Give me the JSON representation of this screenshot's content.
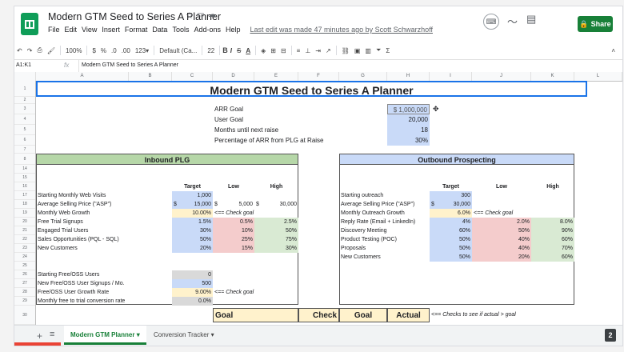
{
  "app": {
    "doc_title": "Modern GTM Seed to Series A Planner",
    "menu": [
      "File",
      "Edit",
      "View",
      "Insert",
      "Format",
      "Data",
      "Tools",
      "Add-ons",
      "Help"
    ],
    "last_edit": "Last edit was made 47 minutes ago by Scott Schwarzhoff",
    "share_label": "Share"
  },
  "toolbar": {
    "zoom": "100%",
    "currency": "$",
    "percent": "%",
    "dec_down": ".0",
    "dec_up": ".00",
    "format": "123▾",
    "font": "Default (Ca...",
    "font_size": "22",
    "bold": "B",
    "italic": "I",
    "strike": "S",
    "text_color": "A"
  },
  "formula": {
    "cell_ref": "A1:K1",
    "fx": "fx",
    "value": "Modern GTM Seed to Series A Planner"
  },
  "columns": [
    "A",
    "B",
    "C",
    "D",
    "E",
    "F",
    "G",
    "H",
    "I",
    "J",
    "K",
    "L"
  ],
  "rows": [
    "1",
    "2",
    "3",
    "4",
    "5",
    "6",
    "7",
    "8",
    "14",
    "15",
    "16",
    "17",
    "18",
    "19",
    "20",
    "21",
    "22",
    "23",
    "24",
    "25",
    "26",
    "27",
    "28",
    "29",
    "30"
  ],
  "sheet": {
    "title": "Modern GTM Seed to Series A Planner",
    "goals": [
      {
        "label": "ARR Goal",
        "value": "$ 1,000,000"
      },
      {
        "label": "User Goal",
        "value": "20,000"
      },
      {
        "label": "Months until next raise",
        "value": "18"
      },
      {
        "label": "Percentage of ARR from PLG at Raise",
        "value": "30%"
      }
    ],
    "inbound": {
      "header": "Inbound PLG",
      "col_target": "Target",
      "col_low": "Low",
      "col_high": "High",
      "rows": [
        {
          "label": "Starting Monthly Web Visits",
          "target": "1,000",
          "low": "",
          "high": ""
        },
        {
          "label": "Average Selling Price (\"ASP\")",
          "target_cur": "$",
          "target": "15,000",
          "low_cur": "$",
          "low": "5,000",
          "high_cur": "$",
          "high": "30,000"
        },
        {
          "label": "Monthly Web Growth",
          "target": "10.00%",
          "note": "<== Check goal"
        },
        {
          "label": "Free Trial Signups",
          "target": "1.5%",
          "low": "0.5%",
          "high": "2.5%"
        },
        {
          "label": "Engaged Trial Users",
          "target": "30%",
          "low": "10%",
          "high": "50%"
        },
        {
          "label": "Sales Opportunities (PQL - SQL)",
          "target": "50%",
          "low": "25%",
          "high": "75%"
        },
        {
          "label": "New Customers",
          "target": "20%",
          "low": "15%",
          "high": "30%"
        }
      ],
      "oss": [
        {
          "label": "Starting Free/OSS Users",
          "value": "0"
        },
        {
          "label": "New Free/OSS User Signups / Mo.",
          "value": "500"
        },
        {
          "label": "Free/OSS User Growth Rate",
          "value": "9.00%",
          "note": "<== Check goal"
        },
        {
          "label": "Monthly free to trial conversion rate",
          "value": "0.0%"
        }
      ]
    },
    "outbound": {
      "header": "Outbound Prospecting",
      "col_target": "Target",
      "col_low": "Low",
      "col_high": "High",
      "rows": [
        {
          "label": "Starting outreach",
          "target": "300",
          "low": "",
          "high": ""
        },
        {
          "label": "Average Selling Price (\"ASP\")",
          "target_cur": "$",
          "target": "30,000"
        },
        {
          "label": "Monthly Outreach Growth",
          "target": "6.0%",
          "note": "<== Check goal"
        },
        {
          "label": "Reply Rate (Email + LinkedIn)",
          "target": "4%",
          "low": "2.0%",
          "high": "8.0%"
        },
        {
          "label": "Discovery Meeting",
          "target": "60%",
          "low": "50%",
          "high": "90%"
        },
        {
          "label": "Product Testing (POC)",
          "target": "50%",
          "low": "40%",
          "high": "60%"
        },
        {
          "label": "Proposals",
          "target": "50%",
          "low": "40%",
          "high": "70%"
        },
        {
          "label": "New Customers",
          "target": "50%",
          "low": "20%",
          "high": "60%"
        }
      ]
    },
    "bottom": {
      "goal": "Goal",
      "check": "Check",
      "goal2": "Goal",
      "actual": "Actual",
      "note": "<== Checks to see if actual > goal"
    }
  },
  "tabs": {
    "active": "Modern GTM Planner",
    "other": "Conversion Tracker",
    "badge": "2"
  },
  "colors": {
    "accent": "#188038",
    "blue_header": "#c9daf8",
    "green_header": "#b6d7a8",
    "yellow": "#fff2cc",
    "pink": "#f4cccc",
    "green": "#d9ead3",
    "grey": "#d9d9d9",
    "blue_cell": "#c9daf8"
  }
}
